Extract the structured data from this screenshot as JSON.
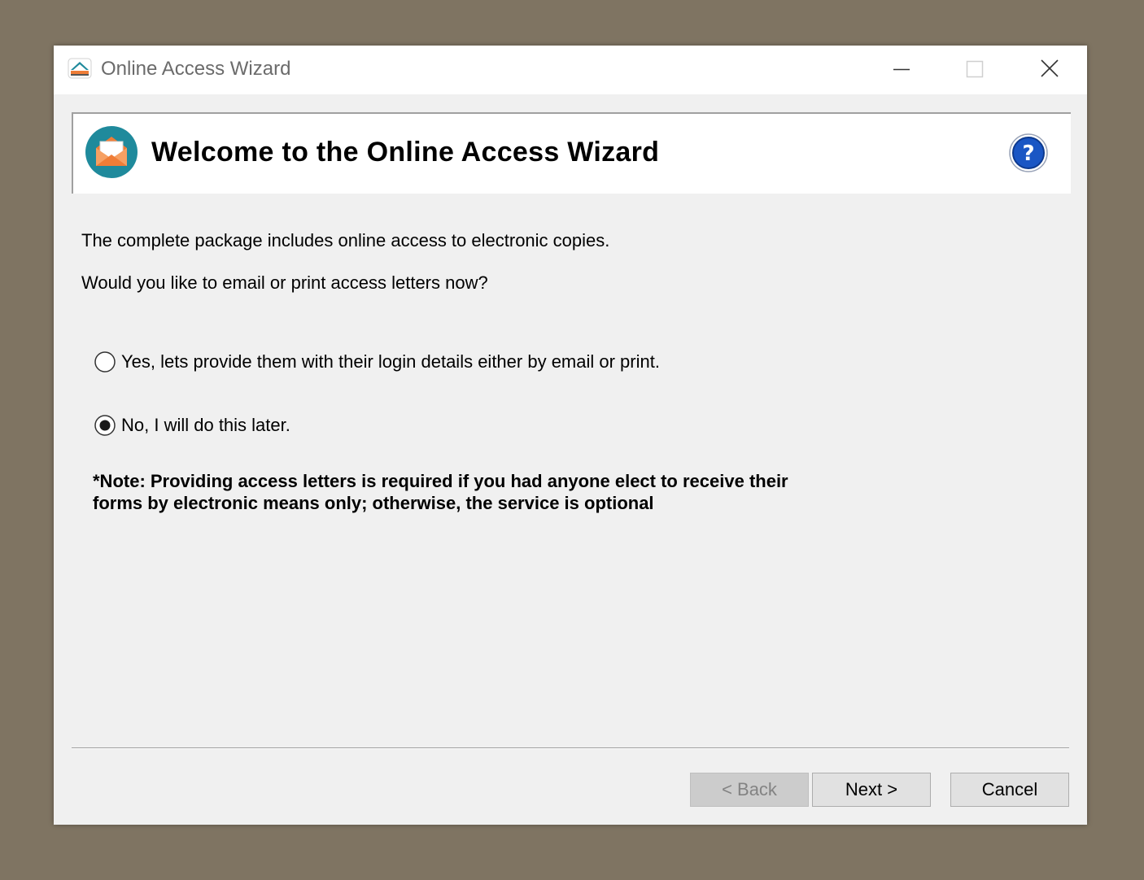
{
  "window": {
    "title": "Online Access Wizard"
  },
  "title_bar_controls": {
    "minimize_icon": "minimize-icon",
    "maximize_icon": "maximize-icon",
    "close_icon": "close-icon"
  },
  "header": {
    "title": "Welcome to the Online Access Wizard",
    "icon": "envelope-icon",
    "help_icon": "help-icon"
  },
  "content": {
    "line1": "The complete package includes online access to electronic copies.",
    "line2": "Would you like to email or print access letters now?",
    "options": [
      {
        "label": "Yes, lets provide them with their login details either by email or print.",
        "selected": false
      },
      {
        "label": "No, I will do this later.",
        "selected": true
      }
    ],
    "note": "*Note: Providing access letters is required if you had anyone elect to receive their forms by electronic means only; otherwise, the service is optional"
  },
  "buttons": {
    "back": "< Back",
    "next": "Next >",
    "cancel": "Cancel"
  },
  "colors": {
    "desktop": "#7f7462",
    "dialog": "#f0f0f0",
    "help_accent": "#1a56c4",
    "envelope_circle": "#1f8a9c",
    "envelope_orange": "#ef7d37"
  }
}
